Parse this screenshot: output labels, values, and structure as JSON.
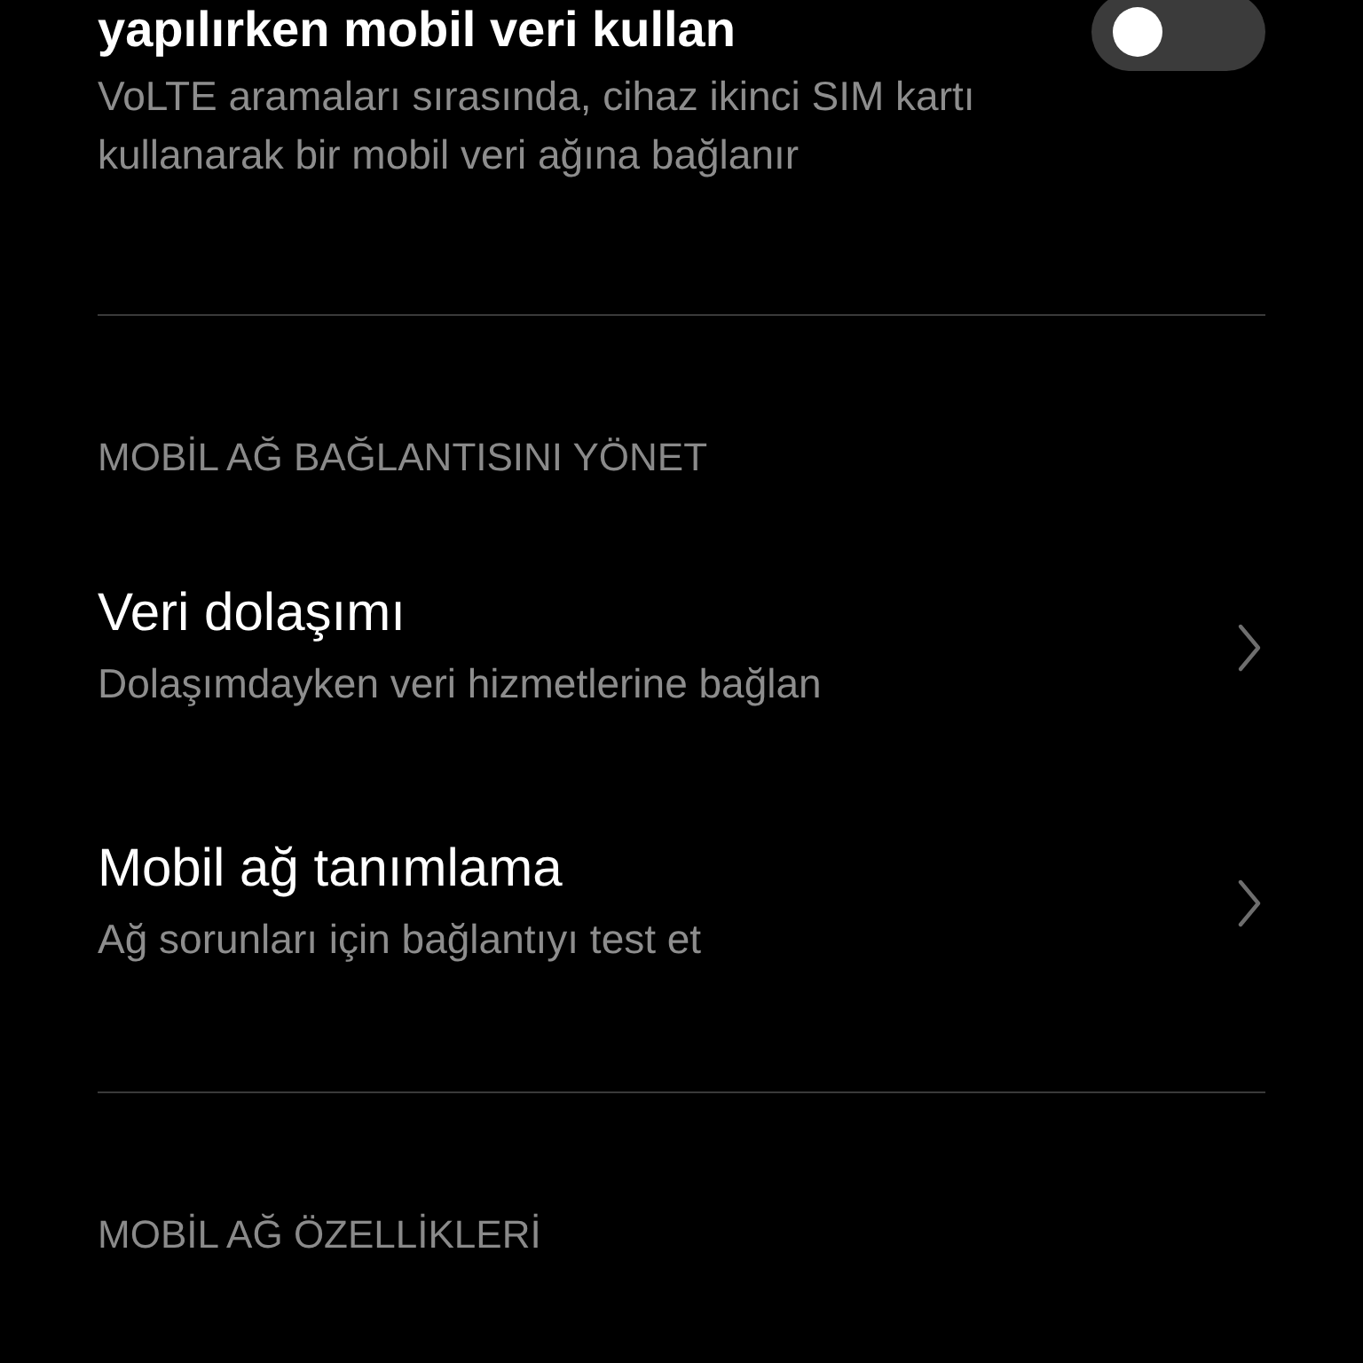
{
  "top_item": {
    "title": "yapılırken mobil veri kullan",
    "subtitle": "VoLTE aramaları sırasında, cihaz ikinci SIM kartı kullanarak bir mobil veri ağına bağlanır",
    "toggle": {
      "on": false
    }
  },
  "sections": [
    {
      "header": "MOBİL AĞ BAĞLANTISINI YÖNET",
      "items": [
        {
          "title": "Veri dolaşımı",
          "subtitle": "Dolaşımdayken veri hizmetlerine bağlan",
          "kind": "link"
        },
        {
          "title": "Mobil ağ tanımlama",
          "subtitle": "Ağ sorunları için bağlantıyı test et",
          "kind": "link"
        }
      ]
    },
    {
      "header": "MOBİL AĞ ÖZELLİKLERİ"
    }
  ]
}
